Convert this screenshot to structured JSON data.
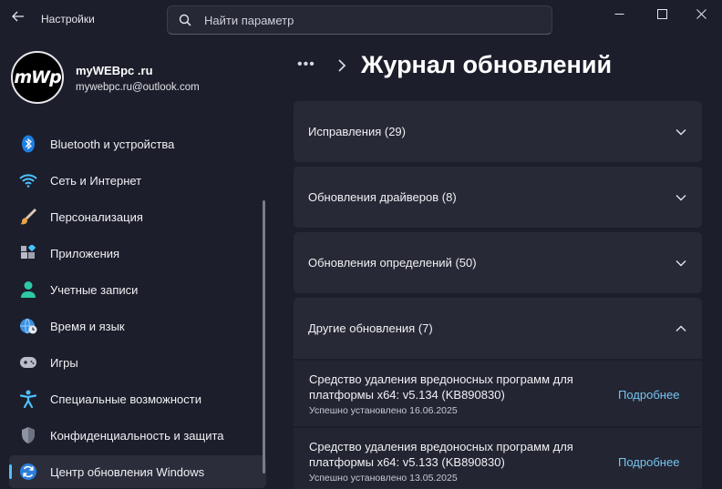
{
  "titlebar": {
    "app_title": "Настройки",
    "search_placeholder": "Найти параметр"
  },
  "profile": {
    "avatar_text": "mWp",
    "name": "myWEBpc .ru",
    "email": "mywebpc.ru@outlook.com"
  },
  "sidebar": {
    "items": [
      {
        "label": "Bluetooth и устройства",
        "icon": "bluetooth-icon"
      },
      {
        "label": "Сеть и Интернет",
        "icon": "wifi-icon"
      },
      {
        "label": "Персонализация",
        "icon": "brush-icon"
      },
      {
        "label": "Приложения",
        "icon": "apps-icon"
      },
      {
        "label": "Учетные записи",
        "icon": "person-icon"
      },
      {
        "label": "Время и язык",
        "icon": "globe-clock-icon"
      },
      {
        "label": "Игры",
        "icon": "gamepad-icon"
      },
      {
        "label": "Специальные возможности",
        "icon": "accessibility-icon"
      },
      {
        "label": "Конфиденциальность и защита",
        "icon": "shield-icon"
      },
      {
        "label": "Центр обновления Windows",
        "icon": "windows-update-icon",
        "active": true
      }
    ]
  },
  "main": {
    "breadcrumb_dots": "•••",
    "page_title": "Журнал обновлений",
    "sections": [
      {
        "label": "Исправления (29)",
        "expanded": false
      },
      {
        "label": "Обновления драйверов (8)",
        "expanded": false
      },
      {
        "label": "Обновления определений (50)",
        "expanded": false
      },
      {
        "label": "Другие обновления (7)",
        "expanded": true
      }
    ],
    "other_updates": [
      {
        "title": "Средство удаления вредоносных программ для платформы x64: v5.134 (KB890830)",
        "status": "Успешно установлено 16.06.2025",
        "link": "Подробнее"
      },
      {
        "title": "Средство удаления вредоносных программ для платформы x64: v5.133 (KB890830)",
        "status": "Успешно установлено 13.05.2025",
        "link": "Подробнее"
      }
    ]
  },
  "colors": {
    "accent": "#4cc2ff",
    "link": "#76c4f0",
    "background": "#1c1e2b",
    "card": "#272936"
  }
}
